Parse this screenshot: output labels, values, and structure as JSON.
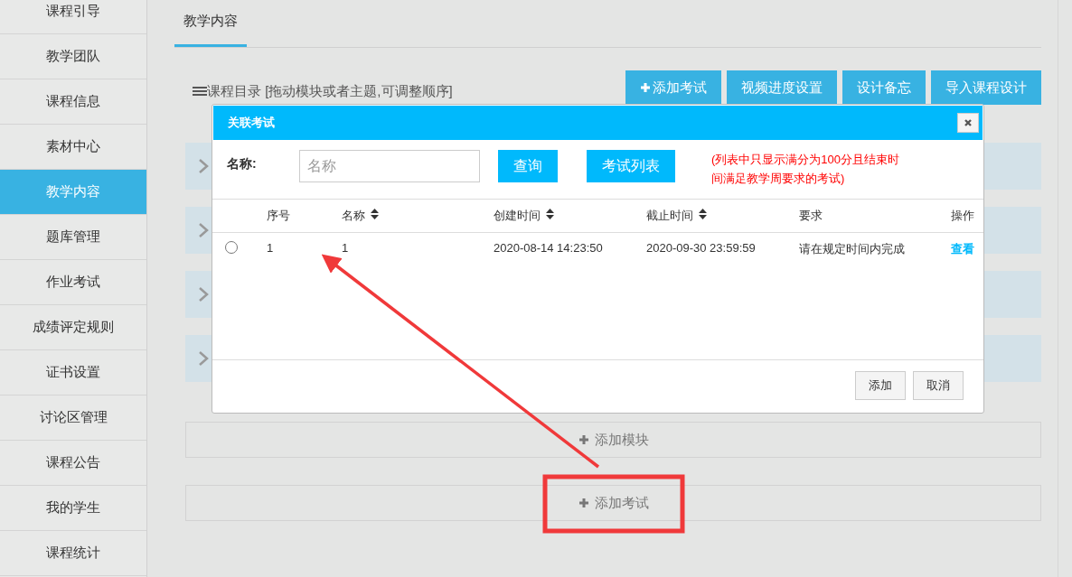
{
  "sidebar": {
    "items": [
      {
        "label": "课程引导",
        "selected": false
      },
      {
        "label": "教学团队",
        "selected": false
      },
      {
        "label": "课程信息",
        "selected": false
      },
      {
        "label": "素材中心",
        "selected": false
      },
      {
        "label": "教学内容",
        "selected": true
      },
      {
        "label": "题库管理",
        "selected": false
      },
      {
        "label": "作业考试",
        "selected": false
      },
      {
        "label": "成绩评定规则",
        "selected": false
      },
      {
        "label": "证书设置",
        "selected": false
      },
      {
        "label": "讨论区管理",
        "selected": false
      },
      {
        "label": "课程公告",
        "selected": false
      },
      {
        "label": "我的学生",
        "selected": false
      },
      {
        "label": "课程统计",
        "selected": false
      }
    ]
  },
  "tabs": [
    {
      "label": "教学内容",
      "selected": true
    }
  ],
  "catalog": {
    "title": "课程目录 [拖动模块或者主题,可调整顺序]"
  },
  "toolbar": [
    {
      "label": "添加考试",
      "kind": "plus"
    },
    {
      "label": "视频进度设置",
      "kind": "plain"
    },
    {
      "label": "设计备忘",
      "kind": "plain"
    },
    {
      "label": "导入课程设计",
      "kind": "plain"
    }
  ],
  "modules": [
    {
      "expanded": false
    },
    {
      "expanded": false
    },
    {
      "expanded": false
    },
    {
      "expanded": false
    }
  ],
  "add_bars": [
    {
      "label": "添加模块"
    },
    {
      "label": "添加考试"
    }
  ],
  "dialog": {
    "title": "关联考试",
    "name_label": "名称:",
    "search": {
      "placeholder": "名称"
    },
    "buttons": [
      "查询",
      "考试列表"
    ],
    "note": "(列表中只显示满分为100分且结束时间满足教学周要求的考试)",
    "table": {
      "columns": [
        {
          "label": "序号",
          "sortable": false
        },
        {
          "label": "名称",
          "sortable": true
        },
        {
          "label": "创建时间",
          "sortable": true
        },
        {
          "label": "截止时间",
          "sortable": true
        },
        {
          "label": "要求",
          "sortable": false
        },
        {
          "label": "操作",
          "sortable": false
        }
      ],
      "rows": [
        {
          "selected": false,
          "cells": [
            "1",
            "1",
            "2020-08-14 14:23:50",
            "2020-09-30 23:59:59",
            "请在规定时间内完成"
          ],
          "action": "查看"
        }
      ]
    },
    "footer_buttons": [
      "添加",
      "取消"
    ]
  }
}
